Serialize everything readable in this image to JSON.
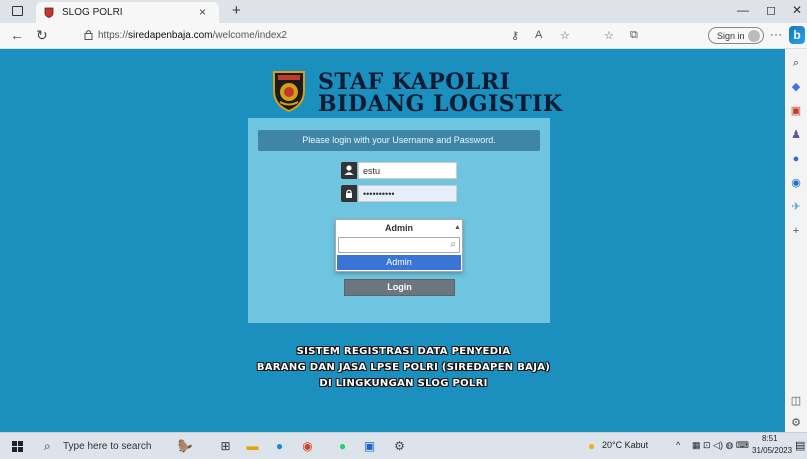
{
  "browser": {
    "tab_title": "SLOG POLRI",
    "tab_close": "×",
    "new_tab": "+",
    "url_prefix": "https://",
    "url_domain": "siredapenbaja.com",
    "url_path": "/welcome/index2",
    "signin_label": "Sign in",
    "more": "···",
    "bing": "b"
  },
  "header": {
    "line1": "STAF KAPOLRI",
    "line2": "BIDANG LOGISTIK"
  },
  "login": {
    "instruction": "Please login with your Username and Password.",
    "username_value": "estu",
    "password_value": "••••••••••",
    "role_selected": "Admin",
    "role_search_value": "",
    "role_options": [
      "Admin"
    ],
    "login_button": "Login"
  },
  "footer_text": {
    "line1": "SISTEM REGISTRASI DATA PENYEDIA",
    "line2": "BARANG DAN JASA LPSE POLRI (SIREDAPEN BAJA)",
    "line3": "DI LINGKUNGAN SLOG POLRI"
  },
  "taskbar": {
    "search_placeholder": "Type here to search",
    "weather": "20°C  Kabut",
    "time": "8:51",
    "date": "31/05/2023"
  },
  "colors": {
    "page_bg": "#1b8fbd",
    "panel_bg": "#6fc4e0",
    "panel_head": "#3f86a6",
    "option_highlight": "#3875d7",
    "button": "#6b7680"
  }
}
